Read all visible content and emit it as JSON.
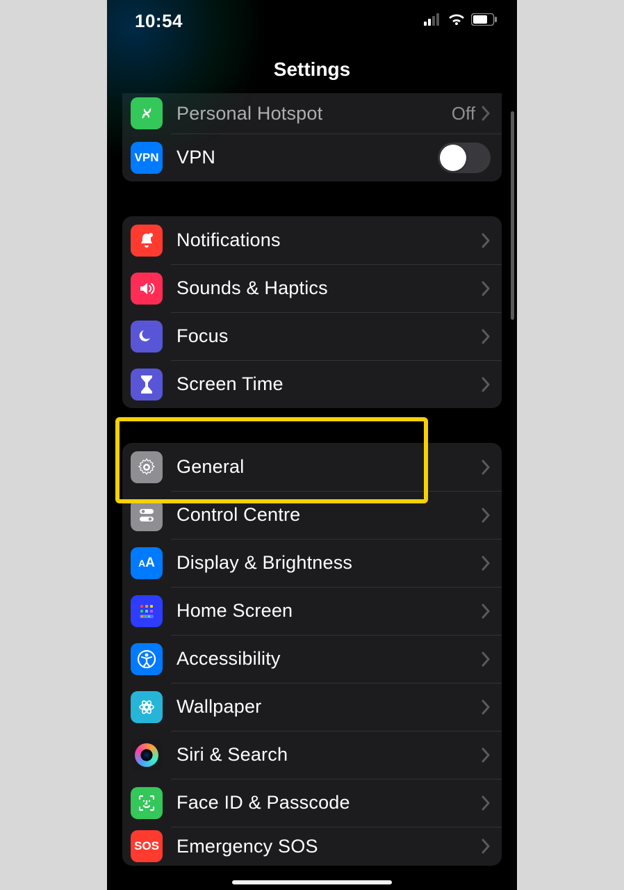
{
  "status": {
    "time": "10:54"
  },
  "header": {
    "title": "Settings"
  },
  "group0": {
    "hotspot": {
      "label": "Personal Hotspot",
      "value": "Off"
    },
    "vpn": {
      "label": "VPN",
      "badge": "VPN"
    }
  },
  "group1": {
    "notifications": "Notifications",
    "sounds": "Sounds & Haptics",
    "focus": "Focus",
    "screentime": "Screen Time"
  },
  "group2": {
    "general": "General",
    "controlcentre": "Control Centre",
    "display": "Display & Brightness",
    "homescreen": "Home Screen",
    "accessibility": "Accessibility",
    "wallpaper": "Wallpaper",
    "siri": "Siri & Search",
    "faceid": "Face ID & Passcode",
    "sos": "Emergency SOS",
    "sos_badge": "SOS",
    "display_badge": "AA"
  }
}
